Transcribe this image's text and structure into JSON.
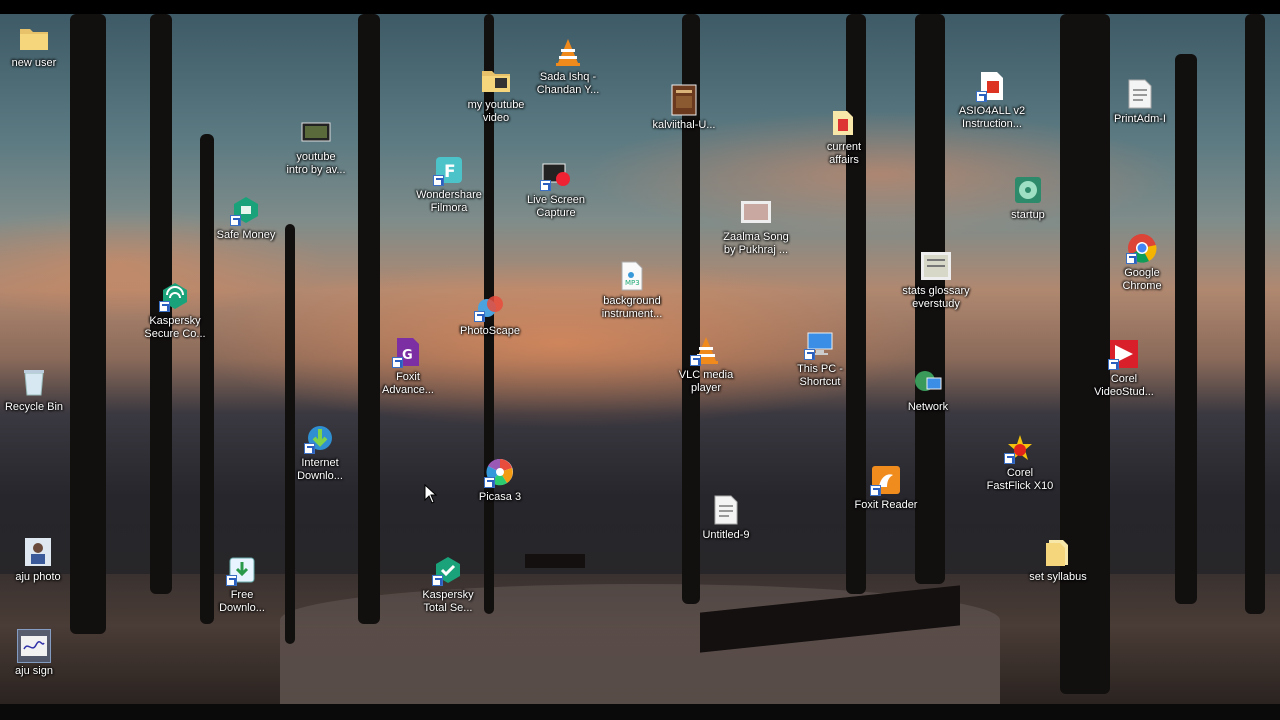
{
  "desktop": {
    "icons": [
      {
        "label": "new user",
        "icon": "folder-user-icon"
      },
      {
        "label": "youtube\nintro by av...",
        "icon": "video-thumbnail-icon"
      },
      {
        "label": "my youtube\nvideo",
        "icon": "folder-icon"
      },
      {
        "label": "Sada Ishq -\nChandan Y...",
        "icon": "vlc-cone-icon"
      },
      {
        "label": "kalviithal-U...",
        "icon": "book-icon"
      },
      {
        "label": "current\naffairs",
        "icon": "pdf-folder-icon"
      },
      {
        "label": "ASIO4ALL v2\nInstruction...",
        "icon": "pdf-shortcut-icon"
      },
      {
        "label": "PrintAdm-I",
        "icon": "document-icon"
      },
      {
        "label": "Wondershare\nFilmora",
        "icon": "filmora-icon"
      },
      {
        "label": "Live Screen\nCapture",
        "icon": "screen-capture-icon"
      },
      {
        "label": "Safe Money",
        "icon": "safe-money-icon"
      },
      {
        "label": "startup",
        "icon": "disc-icon"
      },
      {
        "label": "Zaalma Song\nby Pukhraj ...",
        "icon": "image-thumbnail-icon"
      },
      {
        "label": "Google\nChrome",
        "icon": "chrome-icon"
      },
      {
        "label": "background\ninstrument...",
        "icon": "mp3-file-icon"
      },
      {
        "label": "stats glossary\neverstudy",
        "icon": "image-thumbnail-icon"
      },
      {
        "label": "Kaspersky\nSecure Co...",
        "icon": "kaspersky-secure-icon"
      },
      {
        "label": "PhotoScape",
        "icon": "photoscape-icon"
      },
      {
        "label": "This PC -\nShortcut",
        "icon": "computer-icon"
      },
      {
        "label": "Foxit\nAdvance...",
        "icon": "foxit-advanced-icon"
      },
      {
        "label": "VLC media\nplayer",
        "icon": "vlc-cone-icon"
      },
      {
        "label": "Corel\nVideoStud...",
        "icon": "corel-videostudio-icon"
      },
      {
        "label": "Recycle Bin",
        "icon": "recycle-bin-icon"
      },
      {
        "label": "Network",
        "icon": "network-globe-icon"
      },
      {
        "label": "Internet\nDownlo...",
        "icon": "idm-icon"
      },
      {
        "label": "Corel\nFastFlick X10",
        "icon": "fastflick-icon"
      },
      {
        "label": "Picasa 3",
        "icon": "picasa-icon"
      },
      {
        "label": "Foxit Reader",
        "icon": "foxit-reader-icon"
      },
      {
        "label": "Untitled-9",
        "icon": "document-icon"
      },
      {
        "label": "aju photo",
        "icon": "photo-thumbnail-icon"
      },
      {
        "label": "Free\nDownlo...",
        "icon": "free-download-icon"
      },
      {
        "label": "Kaspersky\nTotal Se...",
        "icon": "kaspersky-total-icon"
      },
      {
        "label": "set syllabus",
        "icon": "folder-icon"
      },
      {
        "label": "aju sign",
        "icon": "signature-thumbnail-icon"
      }
    ]
  }
}
